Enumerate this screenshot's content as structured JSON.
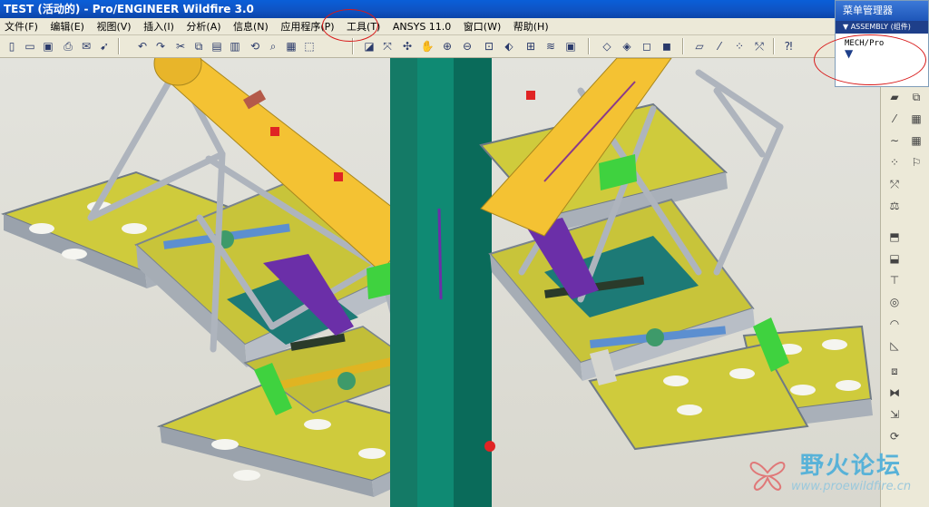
{
  "window": {
    "title": "TEST (活动的) - Pro/ENGINEER Wildfire 3.0"
  },
  "menu": {
    "items": [
      {
        "label": "文件(F)"
      },
      {
        "label": "编辑(E)"
      },
      {
        "label": "视图(V)"
      },
      {
        "label": "插入(I)"
      },
      {
        "label": "分析(A)"
      },
      {
        "label": "信息(N)"
      },
      {
        "label": "应用程序(P)"
      },
      {
        "label": "工具(T)"
      },
      {
        "label": "ANSYS 11.0"
      },
      {
        "label": "窗口(W)"
      },
      {
        "label": "帮助(H)"
      }
    ]
  },
  "menu_manager": {
    "title": "菜单管理器",
    "subtitle": "ASSEMBLY (组件)",
    "item": "MECH/Pro",
    "arrow": "▼"
  },
  "watermark": {
    "text": "野火论坛",
    "url": "www.proewildfire.cn"
  },
  "colors": {
    "titlebar": "#0b53c0",
    "highlight_circle": "#d81818",
    "pole": "#0f8a73",
    "cylinder": "#f2c132",
    "frame": "#b7bdc6",
    "deck": "#c9c53a"
  }
}
